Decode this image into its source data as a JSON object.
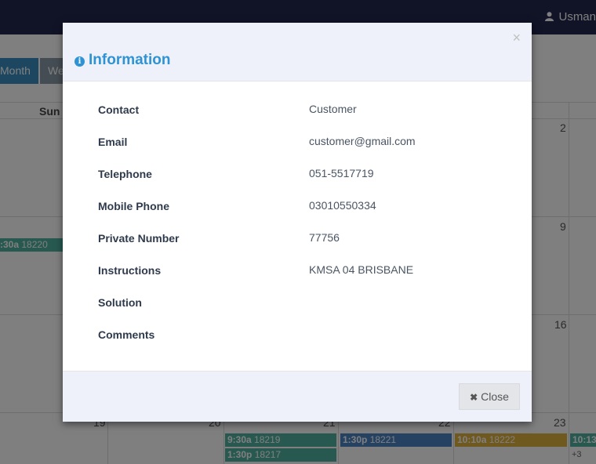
{
  "topbar": {
    "user_name": "Usman",
    "user_icon": "user-icon"
  },
  "calendar": {
    "view_buttons": {
      "month": "Month",
      "week": "We"
    },
    "day_header_sun": "Sun",
    "day_numbers": {
      "r1_c5": "2",
      "r2_c5": "9",
      "r3_c5": "16",
      "r4_c1": "19",
      "r4_c2": "20",
      "r4_c3": "21",
      "r4_c4": "22",
      "r4_c5": "23"
    },
    "events": [
      {
        "time": ":30a",
        "id": "18220",
        "color": "#4fb3a2"
      },
      {
        "time": "9:30a",
        "id": "18219",
        "color": "#4fb3a2"
      },
      {
        "time": "1:30p",
        "id": "18217",
        "color": "#4fb3a2"
      },
      {
        "time": "1:30p",
        "id": "18221",
        "color": "#4c84c4"
      },
      {
        "time": "10:10a",
        "id": "18222",
        "color": "#e0b23c"
      },
      {
        "time": "10:13",
        "id": "",
        "color": "#4fb3a2"
      }
    ],
    "more_link": "+3"
  },
  "modal": {
    "title": "Information",
    "title_icon": "info-circle-icon",
    "close_symbol": "×",
    "fields": [
      {
        "label": "Contact",
        "value": "Customer"
      },
      {
        "label": "Email",
        "value": "customer@gmail.com"
      },
      {
        "label": "Telephone",
        "value": "051-5517719"
      },
      {
        "label": "Mobile Phone",
        "value": "03010550334"
      },
      {
        "label": "Private Number",
        "value": "77756"
      },
      {
        "label": "Instructions",
        "value": "KMSA 04 BRISBANE"
      },
      {
        "label": "Solution",
        "value": ""
      },
      {
        "label": "Comments",
        "value": ""
      }
    ],
    "close_button": {
      "label": "Close",
      "icon": "times-icon"
    }
  },
  "colors": {
    "accent": "#2f93d3",
    "topbar": "#23274f",
    "modal_header": "#eef1f9"
  }
}
